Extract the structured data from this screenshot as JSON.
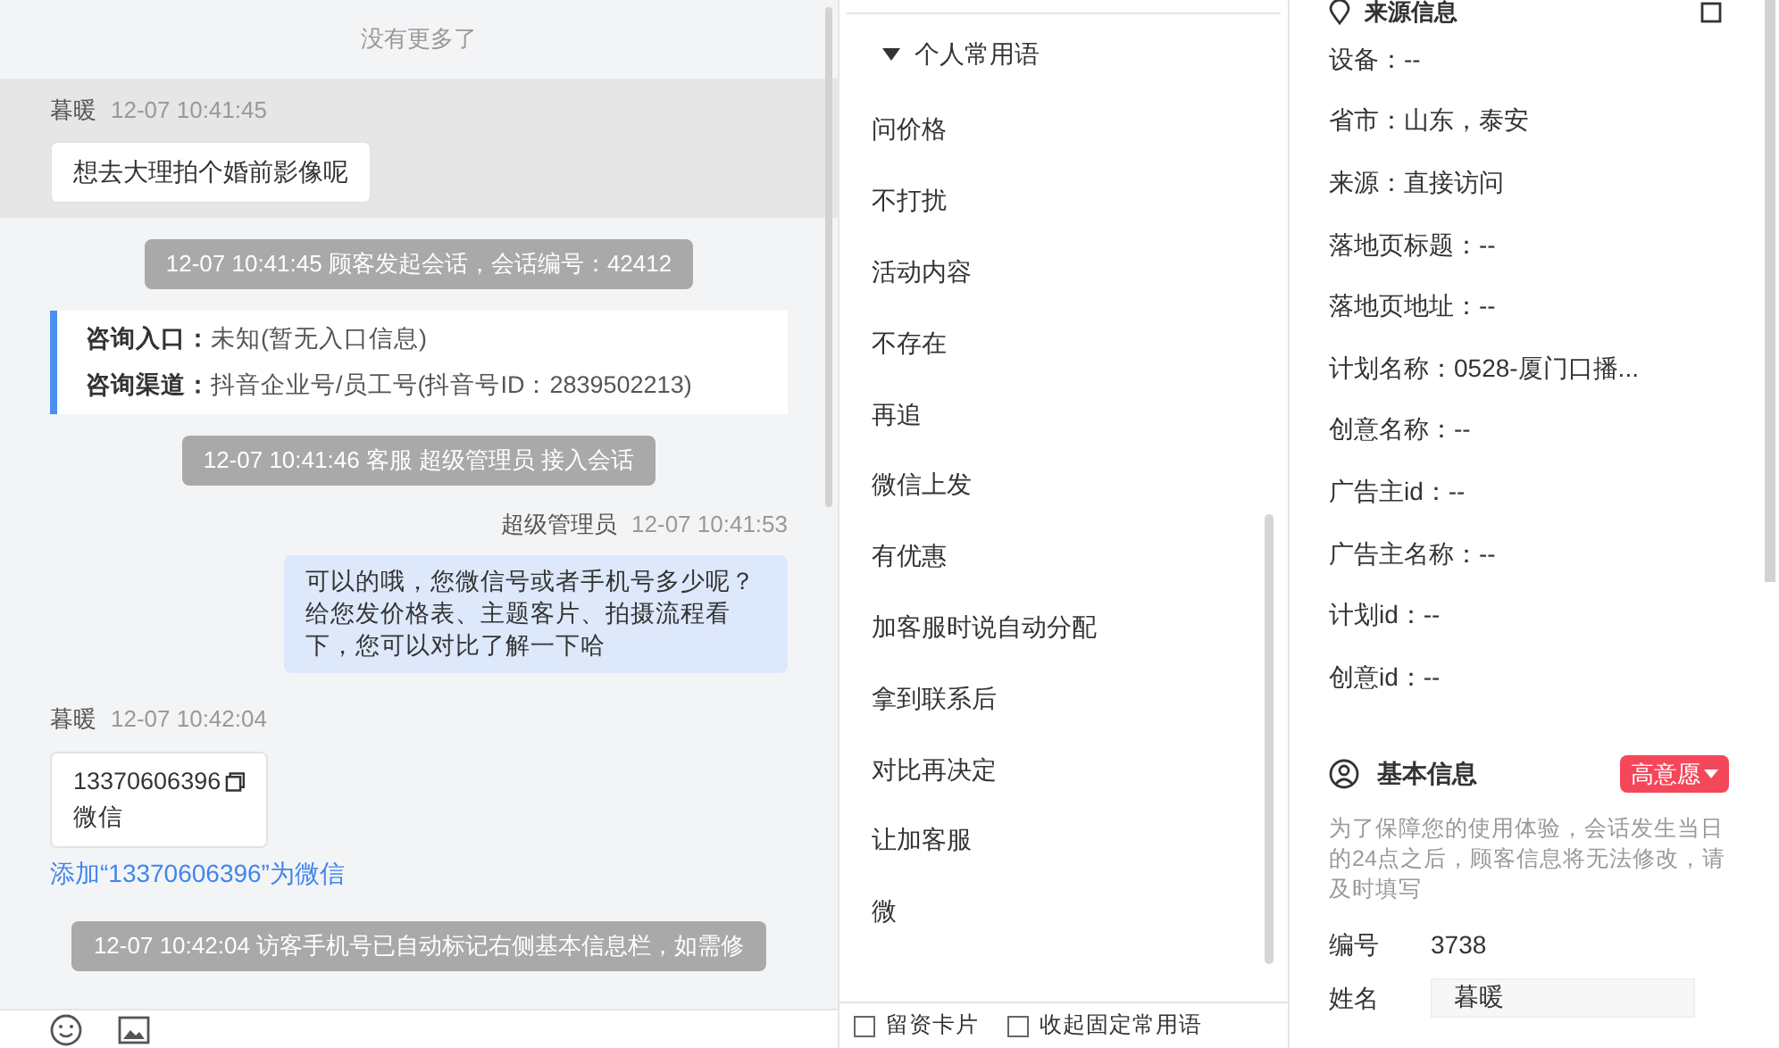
{
  "chat": {
    "no_more": "没有更多了",
    "messages": [
      {
        "kind": "customer",
        "sender": "暮暖",
        "time": "12-07 10:41:45",
        "text": "想去大理拍个婚前影像呢"
      },
      {
        "kind": "system",
        "text": "12-07 10:41:45 顾客发起会话，会话编号：42412"
      },
      {
        "kind": "source",
        "rows": [
          {
            "label": "咨询入口：",
            "value": "未知(暂无入口信息)"
          },
          {
            "label": "咨询渠道：",
            "value": "抖音企业号/员工号(抖音号ID：2839502213)"
          }
        ]
      },
      {
        "kind": "system",
        "text": "12-07 10:41:46 客服 超级管理员 接入会话"
      },
      {
        "kind": "agent",
        "sender": "超级管理员",
        "time": "12-07 10:41:53",
        "text": "可以的哦，您微信号或者手机号多少呢？给您发价格表、主题客片、拍摄流程看下，您可以对比了解一下哈"
      },
      {
        "kind": "contact",
        "sender": "暮暖",
        "time": "12-07 10:42:04",
        "number": "13370606396",
        "type": "微信",
        "link": "添加“13370606396”为微信"
      },
      {
        "kind": "system",
        "text": "12-07 10:42:04 访客手机号已自动标记右侧基本信息栏，如需修"
      }
    ]
  },
  "phrases": {
    "group": {
      "label": "个人常用语",
      "expanded": true
    },
    "items": [
      "问价格",
      "不打扰",
      "活动内容",
      "不存在",
      "再追",
      "微信上发",
      "有优惠",
      "加客服时说自动分配",
      "拿到联系后",
      "对比再决定",
      "让加客服",
      "微"
    ],
    "options": [
      {
        "label": "留资卡片",
        "checked": false
      },
      {
        "label": "收起固定常用语",
        "checked": false
      }
    ]
  },
  "info": {
    "source_title": "来源信息",
    "source_rows": [
      "设备：--",
      "省市：山东，泰安",
      "来源：直接访问",
      "落地页标题：--",
      "落地页地址：--",
      "计划名称：0528-厦门口播...",
      "创意名称：--",
      "广告主id：--",
      "广告主名称：--",
      "计划id：--",
      "创意id：--"
    ],
    "basic_title": "基本信息",
    "intent_tag": "高意愿",
    "note": "为了保障您的使用体验，会话发生当日的24点之后，顾客信息将无法修改，请及时填写",
    "fields": [
      {
        "kind": "text",
        "label": "编号",
        "value": "3738"
      },
      {
        "kind": "input",
        "label": "姓名",
        "value": "暮暖"
      }
    ]
  }
}
